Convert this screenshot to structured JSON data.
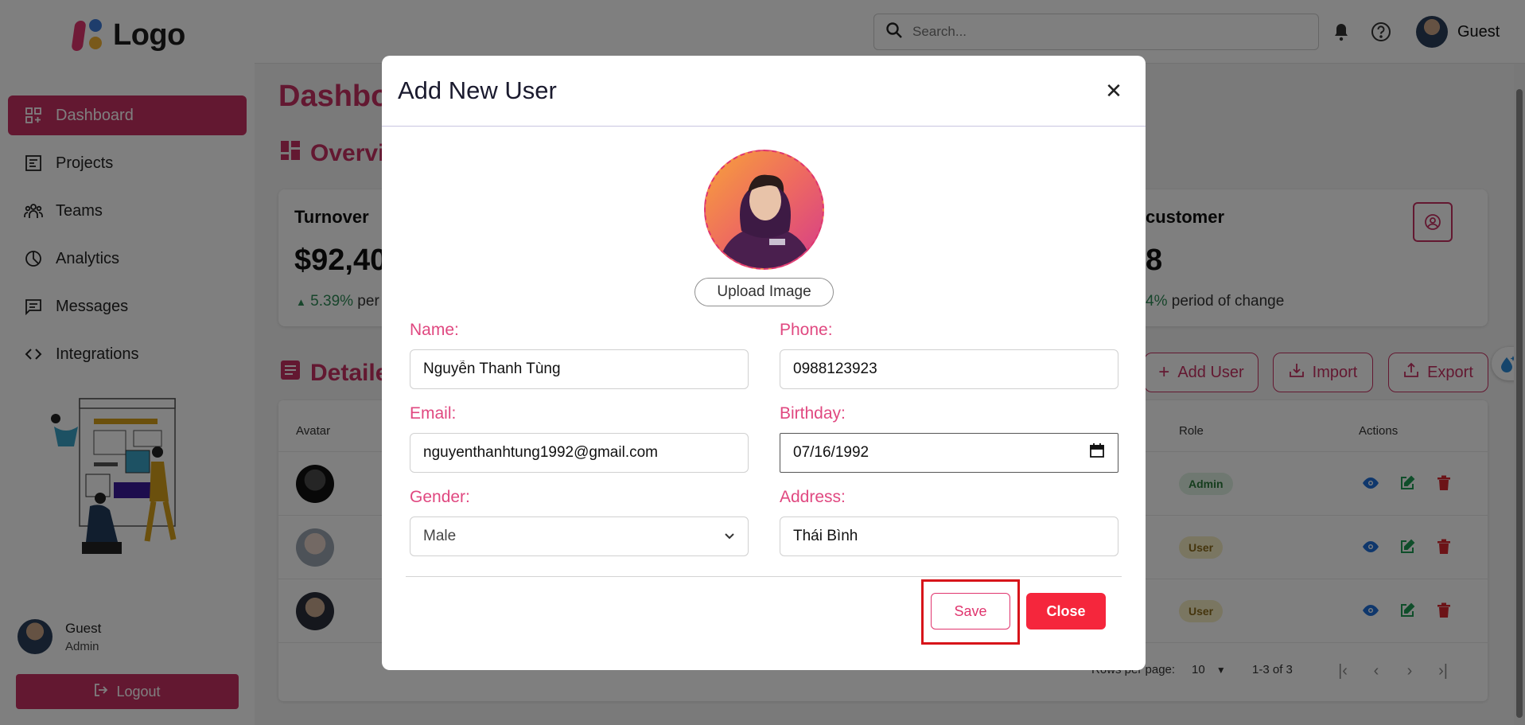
{
  "brand": {
    "logo_text": "Logo"
  },
  "sidebar": {
    "items": [
      {
        "label": "Dashboard",
        "icon": "dashboard-icon",
        "active": true
      },
      {
        "label": "Projects",
        "icon": "projects-icon"
      },
      {
        "label": "Teams",
        "icon": "teams-icon"
      },
      {
        "label": "Analytics",
        "icon": "analytics-icon"
      },
      {
        "label": "Messages",
        "icon": "messages-icon"
      },
      {
        "label": "Integrations",
        "icon": "code-icon"
      }
    ],
    "profile": {
      "name": "Guest",
      "role": "Admin"
    },
    "logout_label": "Logout"
  },
  "header": {
    "search_placeholder": "Search...",
    "user_name": "Guest"
  },
  "page": {
    "title": "Dashbo",
    "overview_title": "Overvi",
    "details_title": "Detaile"
  },
  "cards": {
    "turnover": {
      "label": "Turnover",
      "value": "$92,40",
      "change_pct": "5.39%",
      "change_text": " per"
    },
    "customer": {
      "label": "customer",
      "value": "8",
      "change_pct": "4%",
      "change_text": " period of change"
    }
  },
  "actions": {
    "add_user": "Add User",
    "import": "Import",
    "export": "Export"
  },
  "table": {
    "headers": {
      "avatar": "Avatar",
      "role": "Role",
      "actions": "Actions"
    },
    "rows": [
      {
        "role": "Admin"
      },
      {
        "role": "User"
      },
      {
        "role": "User"
      }
    ],
    "rows_per_page_label": "Rows per page:",
    "rows_per_page_value": "10",
    "range": "1-3 of 3"
  },
  "modal": {
    "title": "Add New User",
    "upload_label": "Upload Image",
    "fields": {
      "name": {
        "label": "Name:",
        "value": "Nguyễn Thanh Tùng"
      },
      "phone": {
        "label": "Phone:",
        "value": "0988123923"
      },
      "email": {
        "label": "Email:",
        "value": "nguyenthanhtung1992@gmail.com"
      },
      "birthday": {
        "label": "Birthday:",
        "value": "07/16/1992"
      },
      "gender": {
        "label": "Gender:",
        "value": "Male"
      },
      "address": {
        "label": "Address:",
        "value": "Thái Bình"
      }
    },
    "save_label": "Save",
    "close_label": "Close"
  },
  "colors": {
    "accent": "#c73163",
    "modal_label": "#e04880",
    "close_button": "#f5263c",
    "highlight": "#d7141a",
    "positive": "#2e8b57"
  }
}
